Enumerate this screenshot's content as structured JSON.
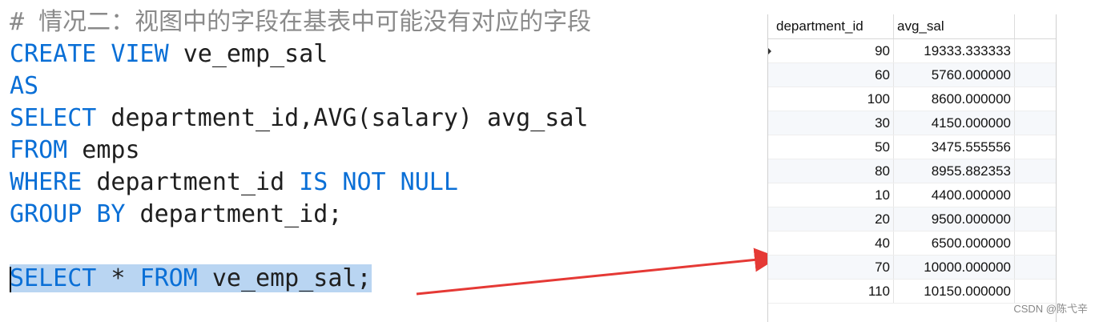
{
  "code": {
    "comment": "# 情况二：视图中的字段在基表中可能没有对应的字段",
    "create_kw": "CREATE VIEW",
    "view_name": " ve_emp_sal",
    "as_kw": "AS",
    "select_kw": "SELECT",
    "select_rest": " department_id,AVG(salary) avg_sal",
    "from_kw": "FROM",
    "from_rest": " emps",
    "where_kw": "WHERE",
    "where_mid": " department_id ",
    "is_not_null_kw": "IS NOT NULL",
    "group_kw": "GROUP BY",
    "group_rest": " department_id;",
    "query_select_kw": "SELECT",
    "query_star": " * ",
    "query_from_kw": "FROM",
    "query_rest": " ve_emp_sal;"
  },
  "result_grid": {
    "columns": [
      "department_id",
      "avg_sal"
    ],
    "rows": [
      [
        "90",
        "19333.333333"
      ],
      [
        "60",
        "5760.000000"
      ],
      [
        "100",
        "8600.000000"
      ],
      [
        "30",
        "4150.000000"
      ],
      [
        "50",
        "3475.555556"
      ],
      [
        "80",
        "8955.882353"
      ],
      [
        "10",
        "4400.000000"
      ],
      [
        "20",
        "9500.000000"
      ],
      [
        "40",
        "6500.000000"
      ],
      [
        "70",
        "10000.000000"
      ],
      [
        "110",
        "10150.000000"
      ]
    ]
  },
  "watermark": "CSDN @陈弋辛",
  "colors": {
    "keyword": "#0a6fd6",
    "comment": "#8a8a8a",
    "selection": "#b9d5f2",
    "arrow": "#e53935"
  }
}
